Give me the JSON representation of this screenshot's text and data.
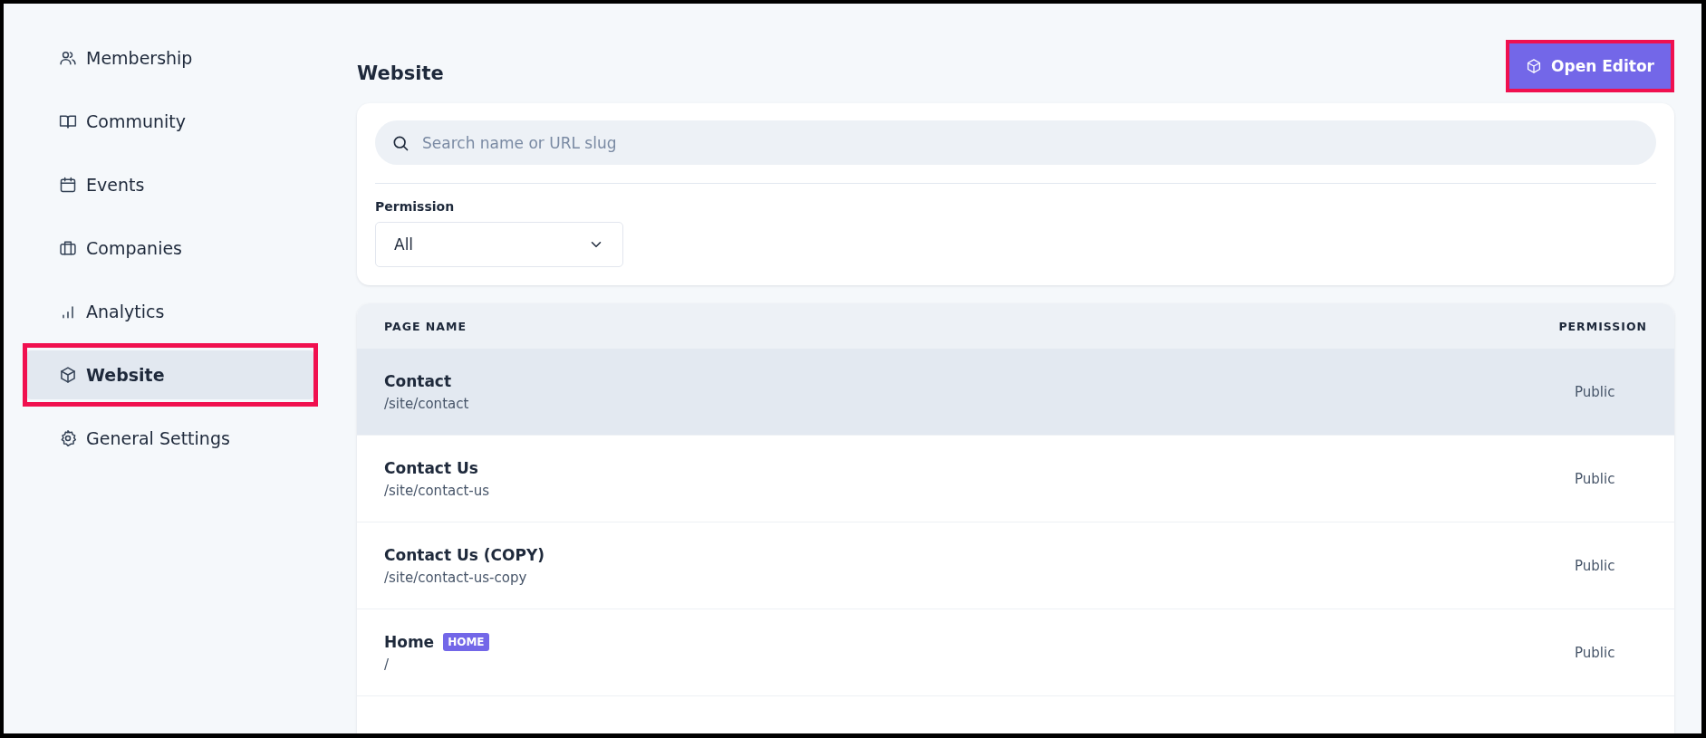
{
  "sidebar": {
    "items": [
      {
        "label": "Membership",
        "selected": false,
        "highlighted": false
      },
      {
        "label": "Community",
        "selected": false,
        "highlighted": false
      },
      {
        "label": "Events",
        "selected": false,
        "highlighted": false
      },
      {
        "label": "Companies",
        "selected": false,
        "highlighted": false
      },
      {
        "label": "Analytics",
        "selected": false,
        "highlighted": false
      },
      {
        "label": "Website",
        "selected": true,
        "highlighted": true
      },
      {
        "label": "General Settings",
        "selected": false,
        "highlighted": false
      }
    ]
  },
  "page": {
    "title": "Website",
    "action": {
      "label": "Open Editor",
      "highlighted": true
    }
  },
  "filters": {
    "search": {
      "placeholder": "Search name or URL slug"
    },
    "permission": {
      "label": "Permission",
      "value": "All"
    }
  },
  "table": {
    "columns": [
      "PAGE NAME",
      "PERMISSION"
    ],
    "rows": [
      {
        "name": "Contact",
        "slug": "/site/contact",
        "badge": null,
        "permission": "Public",
        "hovered": true
      },
      {
        "name": "Contact Us",
        "slug": "/site/contact-us",
        "badge": null,
        "permission": "Public",
        "hovered": false
      },
      {
        "name": "Contact Us (COPY)",
        "slug": "/site/contact-us-copy",
        "badge": null,
        "permission": "Public",
        "hovered": false
      },
      {
        "name": "Home",
        "slug": "/",
        "badge": "HOME",
        "permission": "Public",
        "hovered": false
      }
    ]
  }
}
